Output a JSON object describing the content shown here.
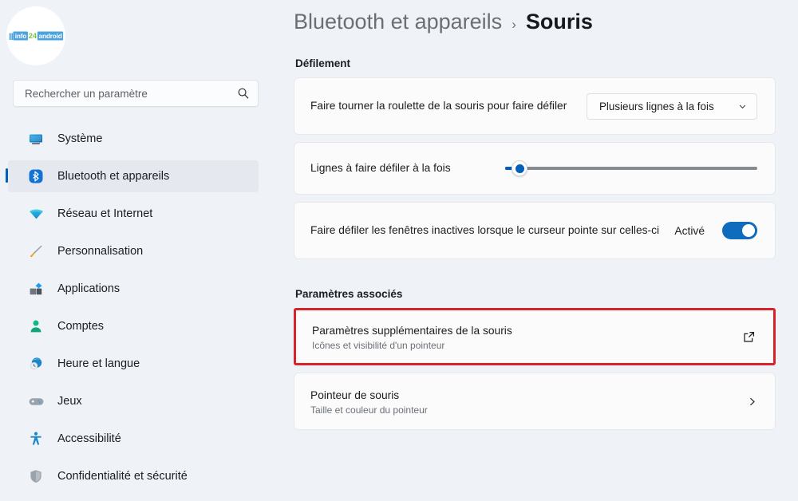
{
  "sidebar": {
    "avatar": {
      "name": "info24android-logo",
      "bars": "|||",
      "chip_left": "info",
      "mid": "24",
      "chip_right": "android"
    },
    "search": {
      "placeholder": "Rechercher un paramètre",
      "value": "",
      "icon": "search-icon"
    },
    "items": [
      {
        "label": "Système",
        "icon": "monitor-icon",
        "selected": false
      },
      {
        "label": "Bluetooth et appareils",
        "icon": "bluetooth-icon",
        "selected": true
      },
      {
        "label": "Réseau et Internet",
        "icon": "wifi-icon",
        "selected": false
      },
      {
        "label": "Personnalisation",
        "icon": "paintbrush-icon",
        "selected": false
      },
      {
        "label": "Applications",
        "icon": "apps-icon",
        "selected": false
      },
      {
        "label": "Comptes",
        "icon": "account-icon",
        "selected": false
      },
      {
        "label": "Heure et langue",
        "icon": "clock-globe-icon",
        "selected": false
      },
      {
        "label": "Jeux",
        "icon": "gamepad-icon",
        "selected": false
      },
      {
        "label": "Accessibilité",
        "icon": "accessibility-icon",
        "selected": false
      },
      {
        "label": "Confidentialité et sécurité",
        "icon": "shield-icon",
        "selected": false
      }
    ]
  },
  "header": {
    "breadcrumb_parent": "Bluetooth et appareils",
    "breadcrumb_separator": "›",
    "breadcrumb_current": "Souris"
  },
  "main": {
    "scroll_section_title": "Défilement",
    "related_section_title": "Paramètres associés",
    "wheel_row": {
      "label": "Faire tourner la roulette de la souris pour faire défiler",
      "dropdown_value": "Plusieurs lignes à la fois",
      "dropdown_icon": "chevron-down-icon"
    },
    "lines_row": {
      "label": "Lignes à faire défiler à la fois",
      "slider_name": "lines-to-scroll-slider"
    },
    "inactive_row": {
      "label": "Faire défiler les fenêtres inactives lorsque le curseur pointe sur celles-ci",
      "state": "Activé",
      "toggle_on": true
    },
    "related_rows": [
      {
        "title": "Paramètres supplémentaires de la souris",
        "subtitle": "Icônes et visibilité d'un pointeur",
        "action_icon": "external-link-icon",
        "highlighted": true
      },
      {
        "title": "Pointeur de souris",
        "subtitle": "Taille et couleur du pointeur",
        "action_icon": "chevron-right-icon",
        "highlighted": false
      }
    ]
  },
  "colors": {
    "accent": "#005fb8",
    "toggle_on": "#0f6cbd",
    "highlight_border": "#d8232a",
    "page_background": "#eff2f7",
    "card_background": "#fbfbfc"
  }
}
